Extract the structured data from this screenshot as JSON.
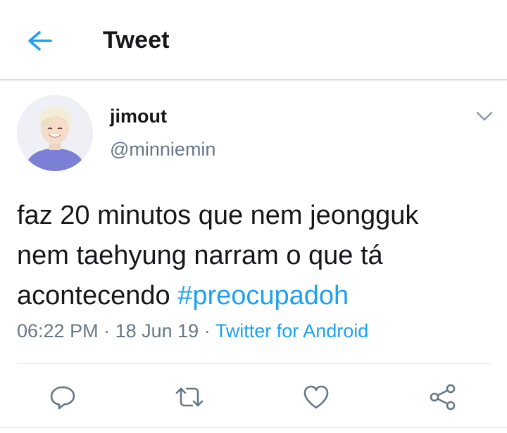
{
  "header": {
    "title": "Tweet",
    "back_icon": "arrow-left-icon"
  },
  "tweet": {
    "display_name": "jimout",
    "handle": "@minniemin",
    "text_line1": "faz 20 minutos que nem jeongguk",
    "text_line2": "nem taehyung narram o que tá",
    "text_line3_prefix": "acontecendo ",
    "hashtag": "#preocupadoh",
    "time": "06:22 PM",
    "separator1": " · ",
    "date": "18 Jun 19",
    "separator2": " · ",
    "source": "Twitter for Android"
  },
  "actions": [
    {
      "name": "reply",
      "icon": "reply-icon"
    },
    {
      "name": "retweet",
      "icon": "retweet-icon"
    },
    {
      "name": "like",
      "icon": "heart-icon"
    },
    {
      "name": "share",
      "icon": "share-icon"
    }
  ],
  "colors": {
    "accent": "#1da1f2",
    "text": "#14171a",
    "secondary": "#657786",
    "border": "#e1e8ed"
  }
}
